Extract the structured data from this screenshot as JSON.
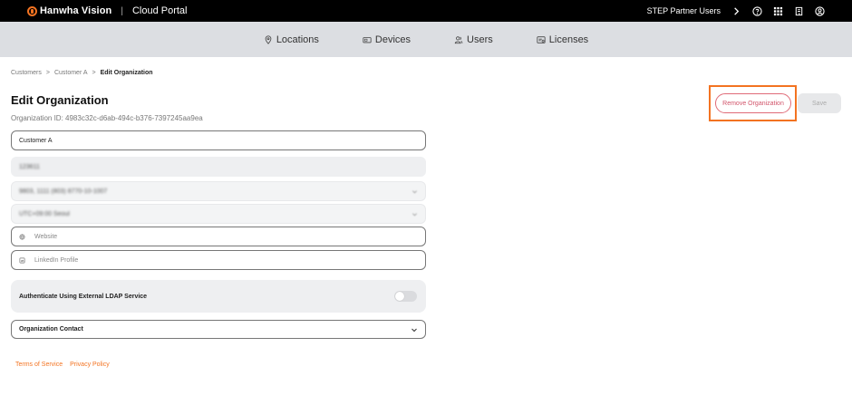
{
  "app": {
    "brand": "Hanwha Vision",
    "separator": "|",
    "portal": "Cloud Portal",
    "accent": "#f37321"
  },
  "topbar": {
    "partner_label": "STEP Partner Users",
    "icons": [
      "chevron-right-icon",
      "help-icon",
      "apps-grid-icon",
      "building-icon",
      "user-account-icon"
    ]
  },
  "nav": {
    "items": [
      {
        "label": "Locations",
        "icon": "location-pin-icon"
      },
      {
        "label": "Devices",
        "icon": "device-icon"
      },
      {
        "label": "Users",
        "icon": "users-icon"
      },
      {
        "label": "Licenses",
        "icon": "license-icon"
      }
    ]
  },
  "breadcrumb": {
    "items": [
      "Customers",
      "Customer A",
      "Edit Organization"
    ],
    "separator": ">"
  },
  "page": {
    "title": "Edit Organization",
    "org_id": "Organization ID: 4983c32c-d6ab-494c-b376-7397245aa9ea"
  },
  "actions": {
    "remove_label": "Remove Organization",
    "save_label": "Save"
  },
  "form": {
    "name_value": "Customer A",
    "blurred_1": "123611",
    "blurred_2": "9803, 1111 (803) 8770-10-1007",
    "blurred_3": "UTC+09:00 Seoul",
    "website_placeholder": "Website",
    "linkedin_placeholder": "LinkedIn Profile",
    "ldap_label": "Authenticate Using External LDAP Service",
    "ldap_enabled": false,
    "contact_label": "Organization Contact"
  },
  "footer": {
    "terms": "Terms of Service",
    "privacy": "Privacy Policy"
  }
}
